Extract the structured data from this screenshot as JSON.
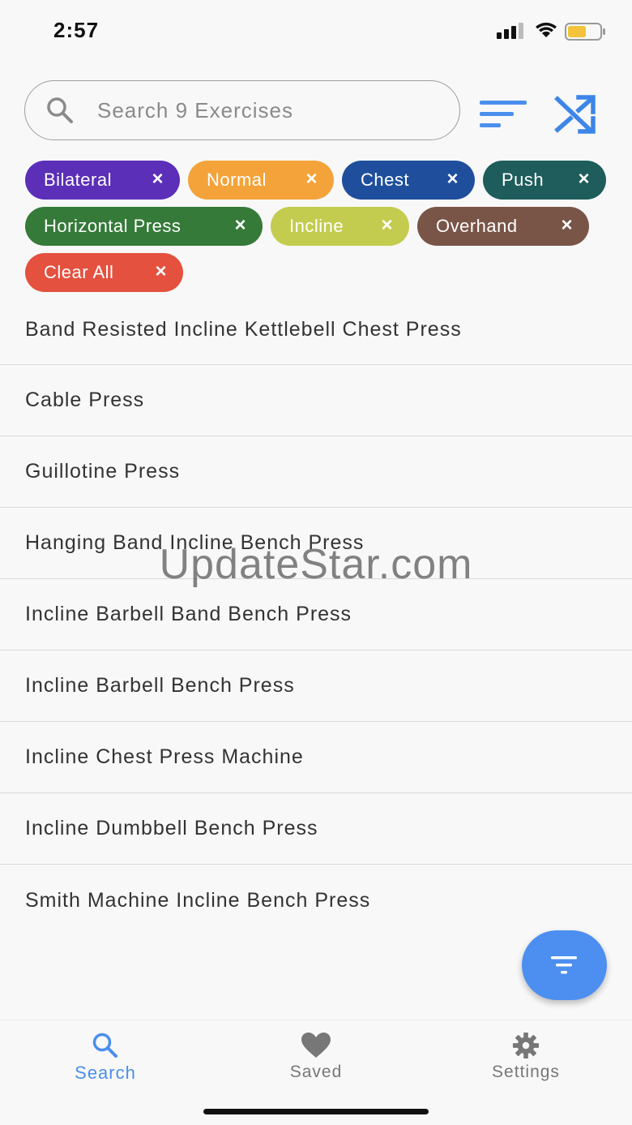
{
  "status_bar": {
    "time": "2:57"
  },
  "search": {
    "placeholder": "Search 9 Exercises",
    "value": ""
  },
  "filters": [
    {
      "label": "Bilateral",
      "color": "#5b2fb8"
    },
    {
      "label": "Normal",
      "color": "#f3a33a"
    },
    {
      "label": "Chest",
      "color": "#1f4f9c"
    },
    {
      "label": "Push",
      "color": "#1f5c5c"
    },
    {
      "label": "Horizontal Press",
      "color": "#357a38"
    },
    {
      "label": "Incline",
      "color": "#c3cc4e"
    },
    {
      "label": "Overhand",
      "color": "#795548"
    },
    {
      "label": "Clear All",
      "color": "#e4513f"
    }
  ],
  "chip_close_glyph": "×",
  "exercises": [
    "Band Resisted Incline Kettlebell Chest Press",
    "Cable Press",
    "Guillotine Press",
    "Hanging Band Incline Bench Press",
    "Incline Barbell Band Bench Press",
    "Incline Barbell Bench Press",
    "Incline Chest Press Machine",
    "Incline Dumbbell Bench Press",
    "Smith Machine Incline Bench Press"
  ],
  "watermark": "UpdateStar.com",
  "bottom_nav": {
    "search": "Search",
    "saved": "Saved",
    "settings": "Settings"
  },
  "colors": {
    "accent": "#4a8fec",
    "fab": "#4d8ff0",
    "inactive": "#777777"
  },
  "icons": {
    "search": "search-icon",
    "sort": "sort-icon",
    "shuffle": "shuffle-icon",
    "filter": "filter-icon",
    "saved": "heart-icon",
    "settings": "gear-icon"
  }
}
